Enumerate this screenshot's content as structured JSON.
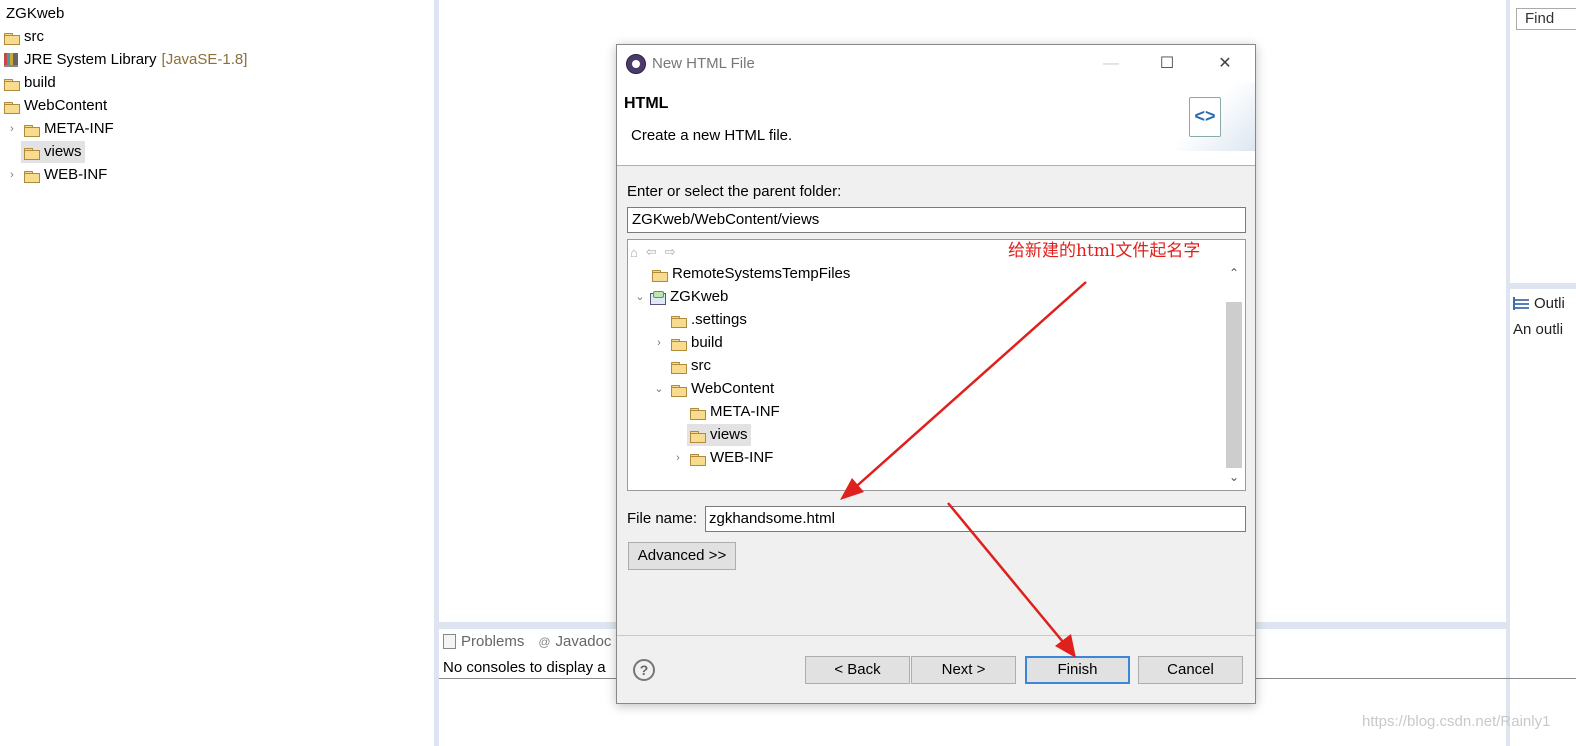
{
  "explorer": {
    "items": [
      {
        "label": "ZGKweb"
      },
      {
        "label": "src"
      },
      {
        "label": "JRE System Library",
        "suffix": "[JavaSE-1.8]"
      },
      {
        "label": "build"
      },
      {
        "label": "WebContent"
      },
      {
        "label": "META-INF"
      },
      {
        "label": "views"
      },
      {
        "label": "WEB-INF"
      }
    ]
  },
  "right_panel": {
    "find_placeholder": "Find",
    "outline_tab": "Outli",
    "outline_text": "An outli"
  },
  "console": {
    "tabs": [
      "Problems",
      "Javadoc"
    ],
    "message": "No consoles to display a"
  },
  "watermark": "https://blog.csdn.net/Rainly1",
  "dialog": {
    "title": "New HTML File",
    "header_title": "HTML",
    "header_desc": "Create a new HTML file.",
    "parent_label": "Enter or select the parent folder:",
    "parent_value": "ZGKweb/WebContent/views",
    "tree": [
      {
        "label": "RemoteSystemsTempFiles"
      },
      {
        "label": "ZGKweb"
      },
      {
        "label": ".settings"
      },
      {
        "label": "build"
      },
      {
        "label": "src"
      },
      {
        "label": "WebContent"
      },
      {
        "label": "META-INF"
      },
      {
        "label": "views"
      },
      {
        "label": "WEB-INF"
      }
    ],
    "annotation": "给新建的html文件起名字",
    "file_label": "File name:",
    "file_value": "zgkhandsome.html",
    "advanced_label": "Advanced >>",
    "help_label": "?",
    "buttons": {
      "back": "< Back",
      "next": "Next >",
      "finish": "Finish",
      "cancel": "Cancel"
    }
  },
  "colors": {
    "annotation_red": "#e0201c",
    "finish_border": "#3c86d8",
    "separator": "#dfe5f0"
  }
}
